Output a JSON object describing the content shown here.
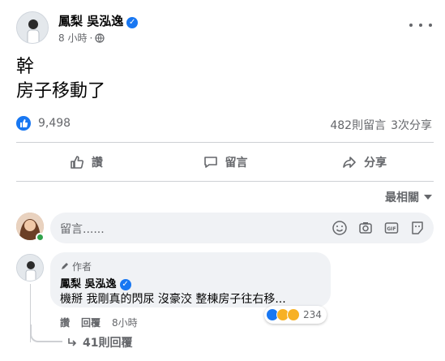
{
  "post": {
    "author": "鳳梨 吳泓逸",
    "verified": true,
    "time": "8 小時",
    "privacy_icon": "globe-icon",
    "lines": [
      "幹",
      "房子移動了"
    ],
    "likes": "9,498",
    "comments_count": "482則留言",
    "shares_count": "3次分享"
  },
  "actions": {
    "like": "讚",
    "comment": "留言",
    "share": "分享"
  },
  "sort": {
    "label": "最相關"
  },
  "composer": {
    "placeholder": "留言......",
    "icons": [
      "emoji-icon",
      "camera-icon",
      "gif-icon",
      "sticker-icon"
    ]
  },
  "comment": {
    "author_tag": "作者",
    "author": "鳳梨 吳泓逸",
    "text": "機掰 我剛真的閃尿 沒豪洨 整棟房子往右移...",
    "reaction_count": "234",
    "like_action": "讚",
    "reply_action": "回覆",
    "time": "8小時",
    "replies": "41則回覆"
  },
  "colors": {
    "accent": "#1877f2",
    "bubble": "#f0f2f5",
    "muted": "#65676b",
    "online": "#31a24c"
  }
}
